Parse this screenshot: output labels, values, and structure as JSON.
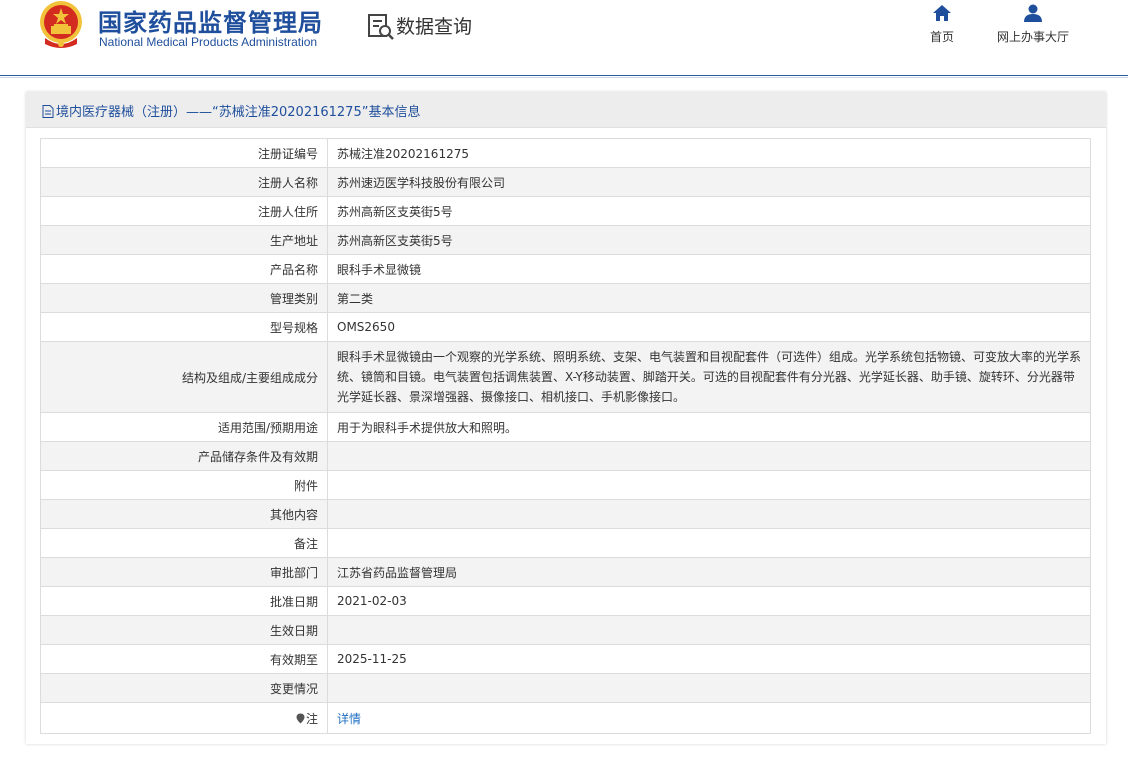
{
  "header": {
    "site_title": "国家药品监督管理局",
    "site_subtitle": "National Medical Products Administration",
    "query_label": "数据查询",
    "nav": {
      "home": "首页",
      "online_hall": "网上办事大厅"
    }
  },
  "panel": {
    "title": "境内医疗器械（注册）——“苏械注准20202161275”基本信息"
  },
  "rows": [
    {
      "label": "注册证编号",
      "value": "苏械注准20202161275"
    },
    {
      "label": "注册人名称",
      "value": "苏州速迈医学科技股份有限公司"
    },
    {
      "label": "注册人住所",
      "value": "苏州高新区支英街5号"
    },
    {
      "label": "生产地址",
      "value": "苏州高新区支英街5号"
    },
    {
      "label": "产品名称",
      "value": "眼科手术显微镜"
    },
    {
      "label": "管理类别",
      "value": "第二类"
    },
    {
      "label": "型号规格",
      "value": "OMS2650"
    },
    {
      "label": "结构及组成/主要组成成分",
      "value": "眼科手术显微镜由一个观察的光学系统、照明系统、支架、电气装置和目视配套件（可选件）组成。光学系统包括物镜、可变放大率的光学系统、镜筒和目镜。电气装置包括调焦装置、X-Y移动装置、脚踏开关。可选的目视配套件有分光器、光学延长器、助手镜、旋转环、分光器带光学延长器、景深增强器、摄像接口、相机接口、手机影像接口。"
    },
    {
      "label": "适用范围/预期用途",
      "value": "用于为眼科手术提供放大和照明。"
    },
    {
      "label": "产品储存条件及有效期",
      "value": ""
    },
    {
      "label": "附件",
      "value": ""
    },
    {
      "label": "其他内容",
      "value": ""
    },
    {
      "label": "备注",
      "value": ""
    },
    {
      "label": "审批部门",
      "value": "江苏省药品监督管理局"
    },
    {
      "label": "批准日期",
      "value": "2021-02-03"
    },
    {
      "label": "生效日期",
      "value": ""
    },
    {
      "label": "有效期至",
      "value": "2025-11-25"
    },
    {
      "label": "变更情况",
      "value": ""
    },
    {
      "label": "注",
      "value": "详情"
    }
  ],
  "colors": {
    "brand_blue": "#1f4f9c",
    "link_blue": "#1f6fc2",
    "emblem_red": "#d32b20",
    "emblem_gold": "#f2c33a"
  }
}
